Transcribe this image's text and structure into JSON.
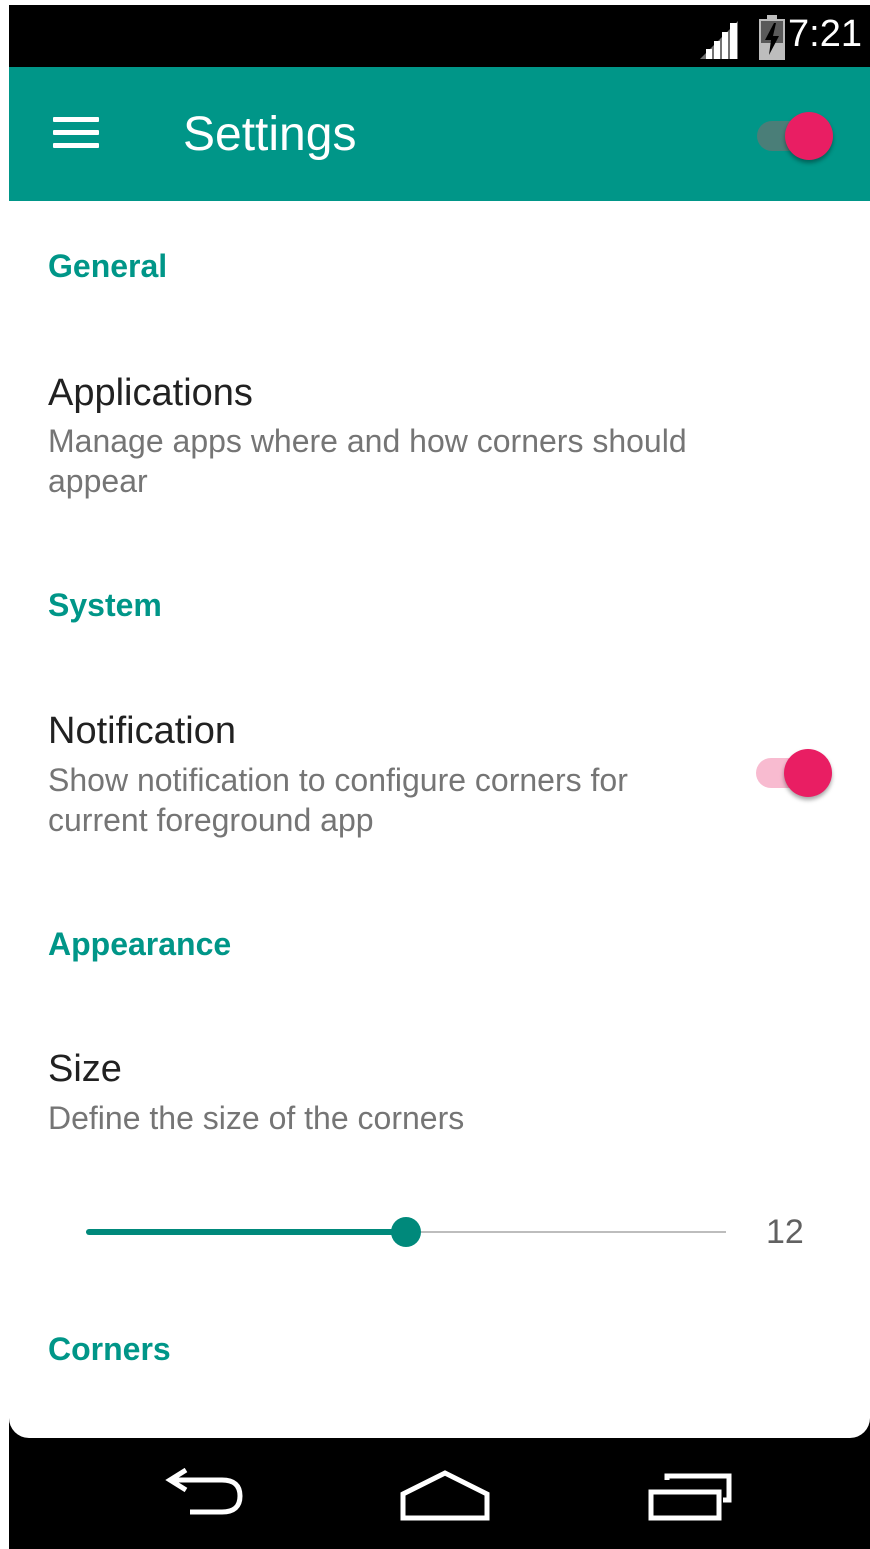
{
  "status_bar": {
    "time": "7:21",
    "signal_icon": "signal-icon",
    "battery_icon": "battery-charging-icon"
  },
  "app_bar": {
    "menu_icon": "menu-icon",
    "title": "Settings",
    "master_switch": {
      "on": true
    }
  },
  "colors": {
    "primary": "#009688",
    "accent": "#e91e63",
    "status_bar": "#000000"
  },
  "sections": {
    "general": {
      "header": "General",
      "applications": {
        "title": "Applications",
        "summary": "Manage apps where and how corners should appear"
      }
    },
    "system": {
      "header": "System",
      "notification": {
        "title": "Notification",
        "summary": "Show notification to configure corners for current foreground app",
        "enabled": true
      }
    },
    "appearance": {
      "header": "Appearance",
      "size": {
        "title": "Size",
        "summary": "Define the size of the corners",
        "value": "12",
        "fraction": 0.5
      }
    },
    "corners": {
      "header": "Corners"
    }
  },
  "nav_bar": {
    "back_icon": "back-icon",
    "home_icon": "home-icon",
    "recents_icon": "recents-icon"
  }
}
